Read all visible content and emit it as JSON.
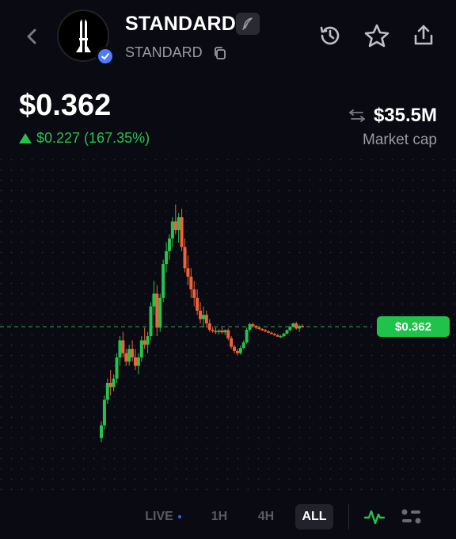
{
  "header": {
    "token_name": "STANDARD",
    "token_symbol": "STANDARD",
    "icons": [
      "back-chevron-icon",
      "feather-icon",
      "copy-icon",
      "history-icon",
      "star-icon",
      "share-icon",
      "verified-check-icon"
    ]
  },
  "price": {
    "current": "$0.362",
    "change": "$0.227 (167.35%)",
    "direction": "up"
  },
  "market_cap": {
    "value": "$35.5M",
    "label": "Market cap"
  },
  "chart": {
    "price_tag": "$0.362"
  },
  "chart_data": {
    "type": "candlestick",
    "current_price": 0.362,
    "candles": [
      [
        0.1,
        0.14,
        0.09,
        0.13
      ],
      [
        0.13,
        0.2,
        0.12,
        0.19
      ],
      [
        0.19,
        0.24,
        0.18,
        0.23
      ],
      [
        0.23,
        0.26,
        0.2,
        0.22
      ],
      [
        0.22,
        0.25,
        0.21,
        0.24
      ],
      [
        0.24,
        0.3,
        0.23,
        0.29
      ],
      [
        0.29,
        0.34,
        0.27,
        0.33
      ],
      [
        0.33,
        0.35,
        0.29,
        0.3
      ],
      [
        0.3,
        0.31,
        0.27,
        0.28
      ],
      [
        0.28,
        0.32,
        0.27,
        0.31
      ],
      [
        0.31,
        0.33,
        0.28,
        0.29
      ],
      [
        0.29,
        0.31,
        0.26,
        0.27
      ],
      [
        0.27,
        0.3,
        0.25,
        0.29
      ],
      [
        0.29,
        0.34,
        0.28,
        0.33
      ],
      [
        0.33,
        0.36,
        0.31,
        0.32
      ],
      [
        0.32,
        0.35,
        0.3,
        0.34
      ],
      [
        0.34,
        0.42,
        0.33,
        0.41
      ],
      [
        0.41,
        0.47,
        0.39,
        0.44
      ],
      [
        0.44,
        0.46,
        0.34,
        0.36
      ],
      [
        0.36,
        0.44,
        0.35,
        0.43
      ],
      [
        0.43,
        0.52,
        0.42,
        0.51
      ],
      [
        0.51,
        0.56,
        0.49,
        0.54
      ],
      [
        0.54,
        0.58,
        0.52,
        0.57
      ],
      [
        0.57,
        0.62,
        0.55,
        0.61
      ],
      [
        0.61,
        0.65,
        0.58,
        0.59
      ],
      [
        0.59,
        0.63,
        0.56,
        0.62
      ],
      [
        0.62,
        0.64,
        0.54,
        0.55
      ],
      [
        0.55,
        0.57,
        0.49,
        0.5
      ],
      [
        0.5,
        0.53,
        0.46,
        0.48
      ],
      [
        0.48,
        0.5,
        0.43,
        0.45
      ],
      [
        0.45,
        0.47,
        0.41,
        0.43
      ],
      [
        0.43,
        0.45,
        0.39,
        0.4
      ],
      [
        0.4,
        0.42,
        0.37,
        0.38
      ],
      [
        0.38,
        0.41,
        0.36,
        0.39
      ],
      [
        0.39,
        0.4,
        0.36,
        0.37
      ],
      [
        0.37,
        0.38,
        0.35,
        0.355
      ],
      [
        0.355,
        0.362,
        0.348,
        0.352
      ],
      [
        0.352,
        0.36,
        0.345,
        0.35
      ],
      [
        0.35,
        0.356,
        0.344,
        0.353
      ],
      [
        0.353,
        0.36,
        0.345,
        0.349
      ],
      [
        0.349,
        0.356,
        0.342,
        0.354
      ],
      [
        0.354,
        0.358,
        0.33,
        0.335
      ],
      [
        0.335,
        0.34,
        0.31,
        0.315
      ],
      [
        0.315,
        0.32,
        0.3,
        0.305
      ],
      [
        0.305,
        0.31,
        0.295,
        0.3
      ],
      [
        0.3,
        0.318,
        0.296,
        0.312
      ],
      [
        0.312,
        0.33,
        0.31,
        0.325
      ],
      [
        0.325,
        0.36,
        0.322,
        0.355
      ],
      [
        0.355,
        0.372,
        0.35,
        0.368
      ],
      [
        0.368,
        0.372,
        0.36,
        0.364
      ],
      [
        0.364,
        0.366,
        0.356,
        0.36
      ],
      [
        0.36,
        0.362,
        0.354,
        0.357
      ],
      [
        0.357,
        0.359,
        0.352,
        0.354
      ],
      [
        0.354,
        0.357,
        0.349,
        0.351
      ],
      [
        0.351,
        0.354,
        0.347,
        0.348
      ],
      [
        0.348,
        0.351,
        0.344,
        0.345
      ],
      [
        0.345,
        0.348,
        0.341,
        0.342
      ],
      [
        0.342,
        0.345,
        0.338,
        0.339
      ],
      [
        0.339,
        0.343,
        0.336,
        0.34
      ],
      [
        0.34,
        0.348,
        0.338,
        0.346
      ],
      [
        0.346,
        0.356,
        0.344,
        0.354
      ],
      [
        0.354,
        0.364,
        0.352,
        0.362
      ],
      [
        0.362,
        0.372,
        0.36,
        0.37
      ],
      [
        0.37,
        0.374,
        0.355,
        0.358
      ],
      [
        0.358,
        0.366,
        0.35,
        0.364
      ],
      [
        0.364,
        0.368,
        0.36,
        0.362
      ]
    ]
  },
  "timeframes": {
    "live": "LIVE",
    "h1": "1H",
    "h4": "4H",
    "all": "ALL",
    "selected": "ALL"
  },
  "colors": {
    "background": "#0a0a12",
    "up": "#27c24c",
    "down": "#f0623a",
    "muted": "#9a9aa6",
    "verified": "#4f7cff"
  }
}
